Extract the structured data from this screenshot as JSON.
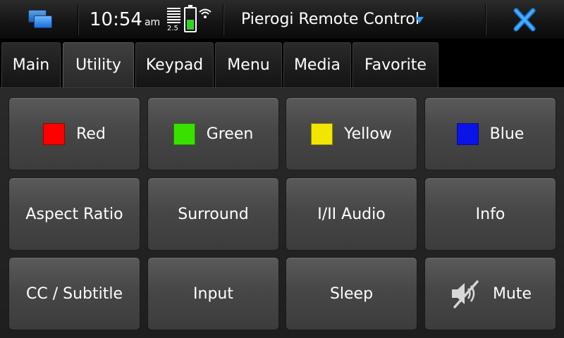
{
  "status": {
    "time": "10:54",
    "ampm": "am",
    "signal_label": "2.5",
    "battery_level": 0.45
  },
  "app": {
    "title": "Pierogi Remote Control"
  },
  "tabs": [
    {
      "label": "Main",
      "active": false
    },
    {
      "label": "Utility",
      "active": true
    },
    {
      "label": "Keypad",
      "active": false
    },
    {
      "label": "Menu",
      "active": false
    },
    {
      "label": "Media",
      "active": false
    },
    {
      "label": "Favorite",
      "active": false
    }
  ],
  "buttons": [
    {
      "label": "Red",
      "swatch": "#ff0000"
    },
    {
      "label": "Green",
      "swatch": "#3ae000"
    },
    {
      "label": "Yellow",
      "swatch": "#f2e600"
    },
    {
      "label": "Blue",
      "swatch": "#0a14e8"
    },
    {
      "label": "Aspect Ratio"
    },
    {
      "label": "Surround"
    },
    {
      "label": "I/II Audio"
    },
    {
      "label": "Info"
    },
    {
      "label": "CC / Subtitle"
    },
    {
      "label": "Input"
    },
    {
      "label": "Sleep"
    },
    {
      "label": "Mute",
      "icon": "mute-icon"
    }
  ],
  "colors": {
    "accent": "#2b96ff",
    "battery": "#35d424"
  }
}
